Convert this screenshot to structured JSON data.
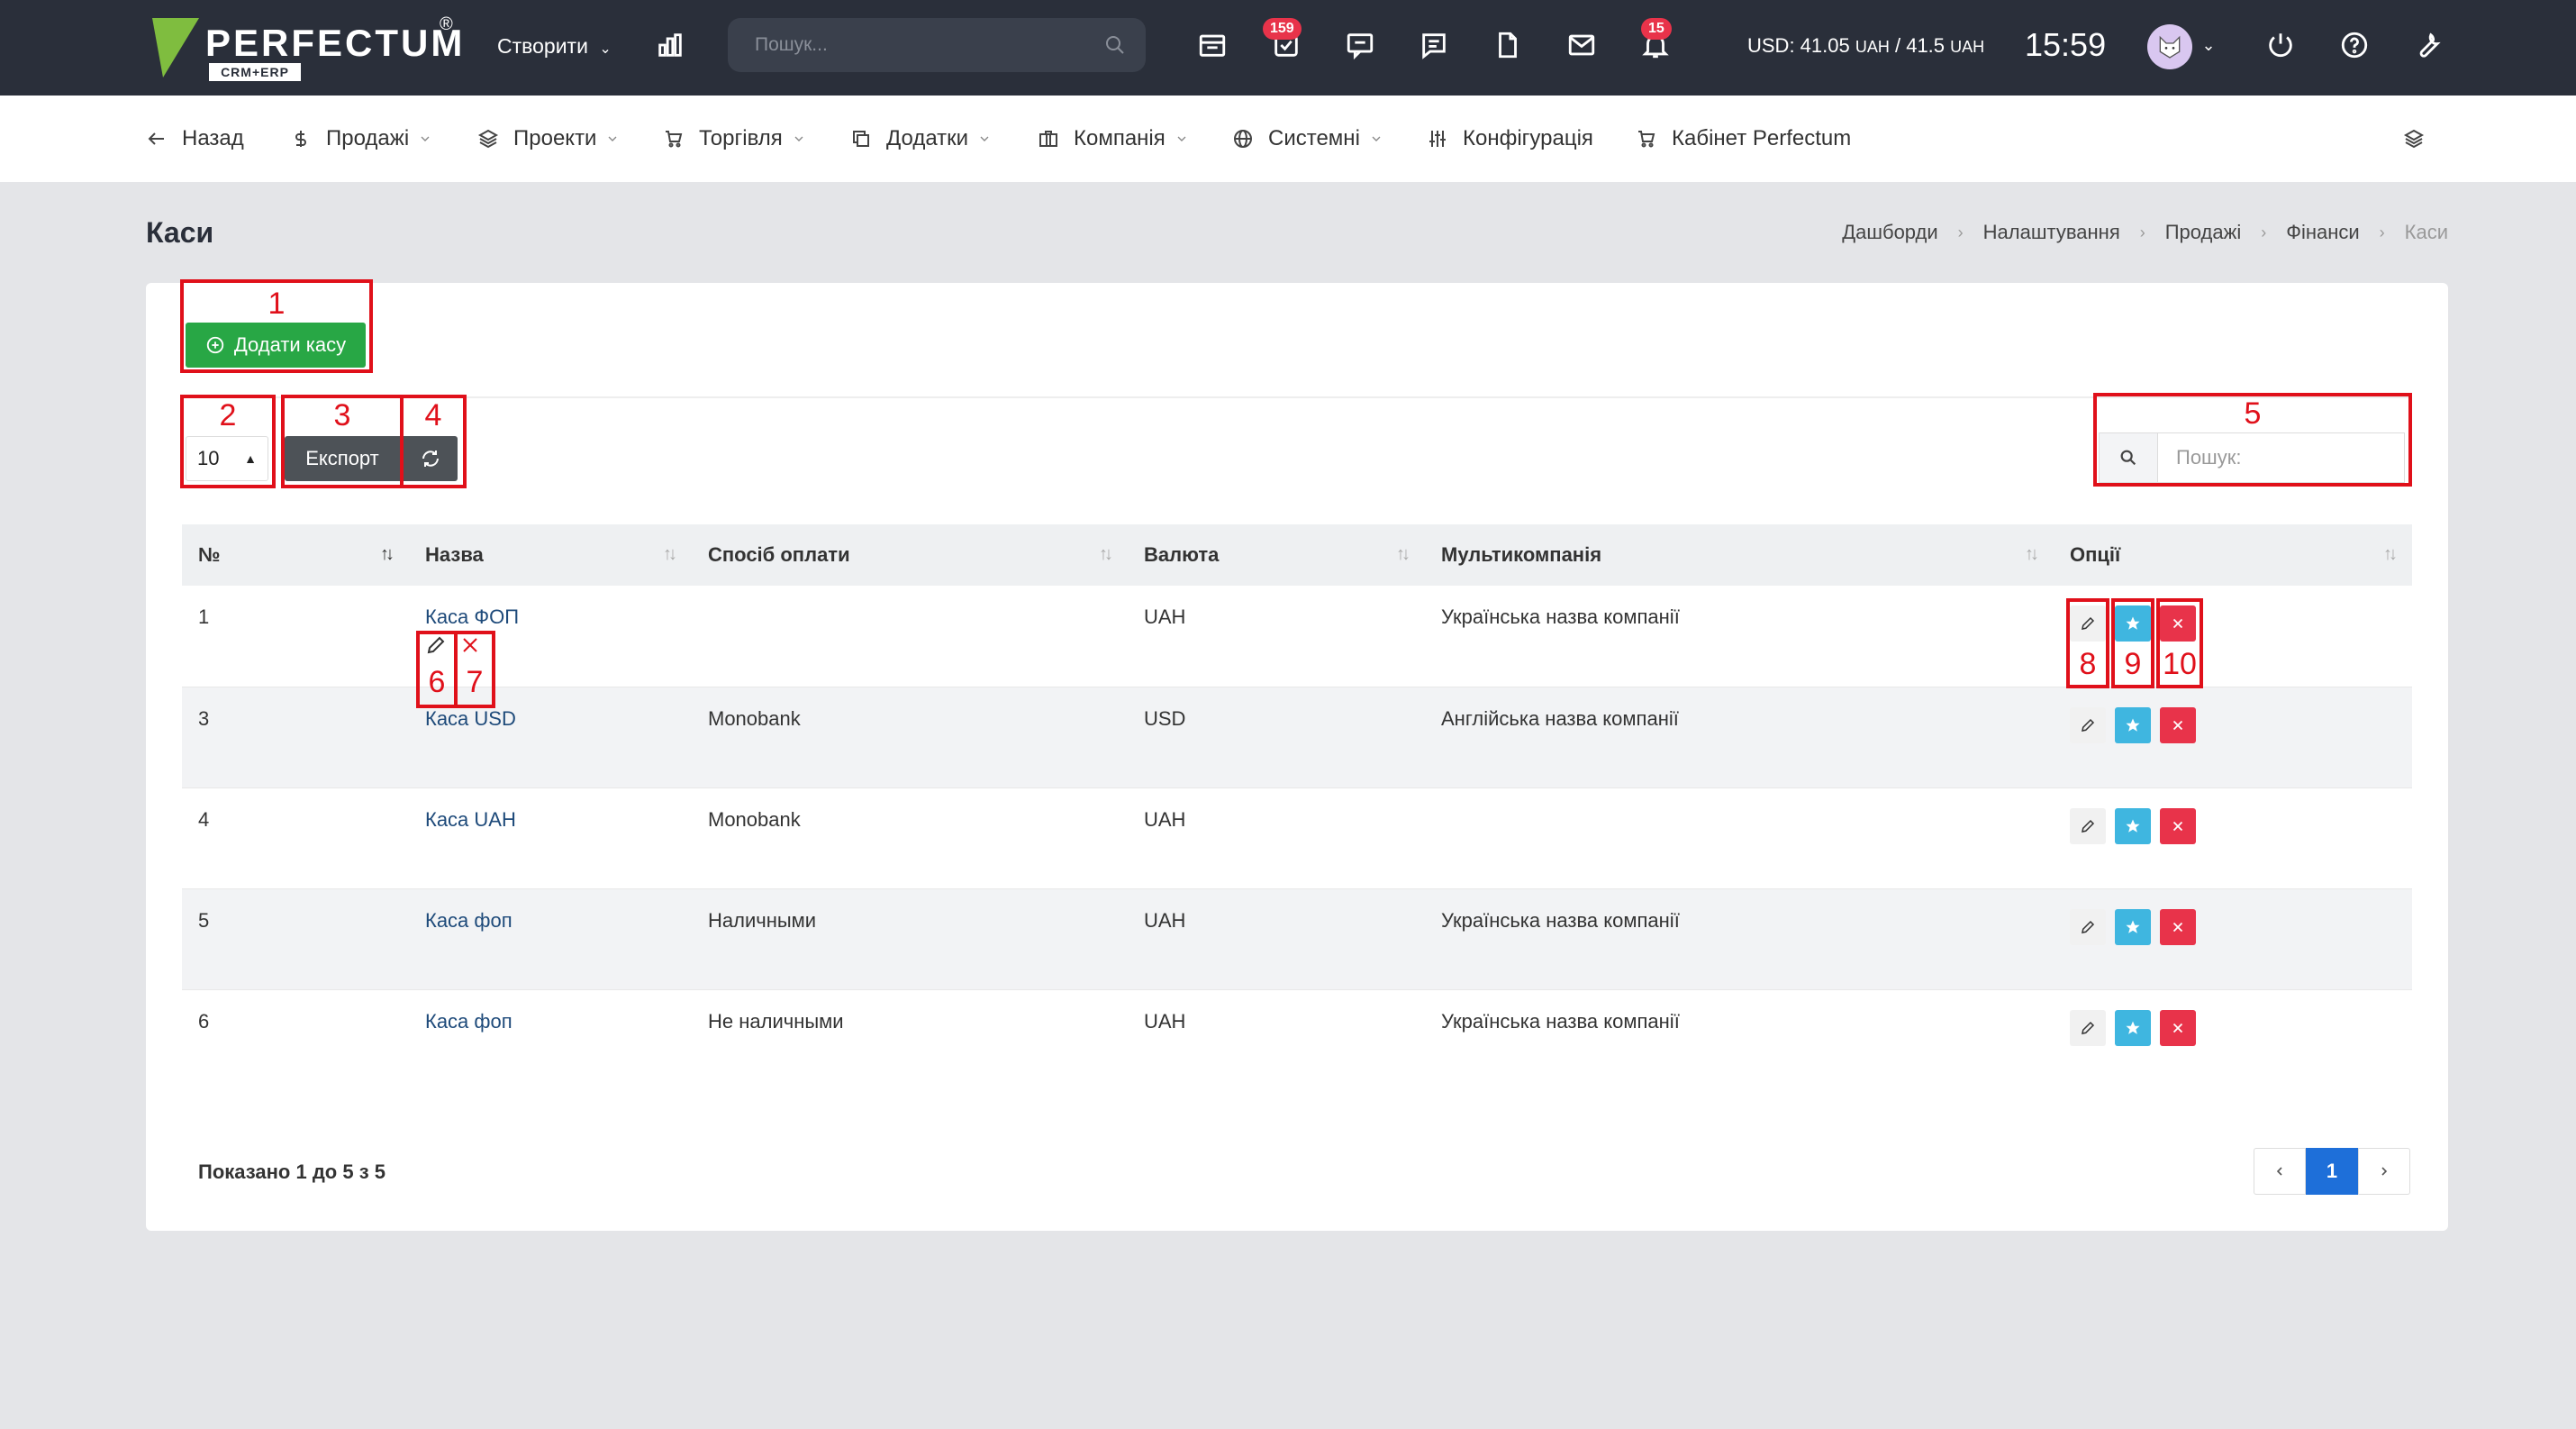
{
  "topbar": {
    "logo_text": "PERFECTUM",
    "logo_sub": "CRM+ERP",
    "logo_reg": "®",
    "create_label": "Створити",
    "search_placeholder": "Пошук...",
    "tasks_badge": "159",
    "notifications_badge": "15",
    "rate_usd_label": "USD: 41.05",
    "rate_unit1": "UAH",
    "rate_sep": " / 41.5",
    "rate_unit2": "UAH",
    "clock": "15:59"
  },
  "nav": {
    "back": "Назад",
    "sales": "Продажі",
    "projects": "Проекти",
    "trade": "Торгівля",
    "addons": "Додатки",
    "company": "Компанія",
    "system": "Системні",
    "config": "Конфігурація",
    "cabinet": "Кабінет Perfectum"
  },
  "page": {
    "title": "Каси",
    "breadcrumb": [
      "Дашборди",
      "Налаштування",
      "Продажі",
      "Фінанси",
      "Каси"
    ]
  },
  "toolbar": {
    "add_label": "Додати касу",
    "page_size": "10",
    "export_label": "Експорт",
    "search_placeholder": "Пошук:"
  },
  "table": {
    "columns": [
      "№",
      "Назва",
      "Спосіб оплати",
      "Валюта",
      "Мультикомпанія",
      "Опції"
    ],
    "rows": [
      {
        "id": "1",
        "name": "Каса ФОП",
        "payment": "",
        "currency": "UAH",
        "company": "Українська назва компанії"
      },
      {
        "id": "3",
        "name": "Каса USD",
        "payment": "Monobank",
        "currency": "USD",
        "company": "Англійська назва компанії"
      },
      {
        "id": "4",
        "name": "Каса UAH",
        "payment": "Monobank",
        "currency": "UAH",
        "company": ""
      },
      {
        "id": "5",
        "name": "Каса фоп",
        "payment": "Наличными",
        "currency": "UAH",
        "company": "Українська назва компанії"
      },
      {
        "id": "6",
        "name": "Каса фоп",
        "payment": "Не наличными",
        "currency": "UAH",
        "company": "Українська назва компанії"
      }
    ]
  },
  "footer": {
    "info": "Показано 1 до 5 з 5",
    "current_page": "1"
  },
  "annotations": [
    "1",
    "2",
    "3",
    "4",
    "5",
    "6",
    "7",
    "8",
    "9",
    "10"
  ],
  "colors": {
    "topbar": "#2a2f3a",
    "add_button": "#28a745",
    "star_button": "#3fb6e0",
    "delete_button": "#e8334a",
    "annotation": "#e0101a",
    "pager_active": "#1e6fd9"
  }
}
